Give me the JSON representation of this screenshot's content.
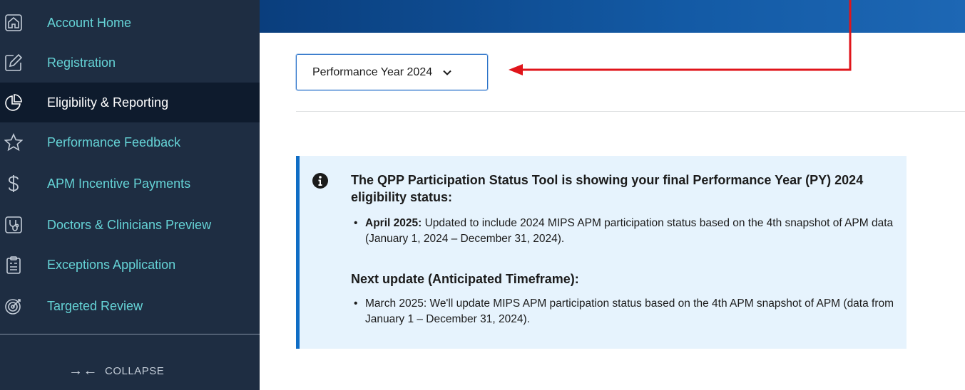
{
  "sidebar": {
    "items": [
      {
        "label": "Account Home",
        "icon": "home-icon"
      },
      {
        "label": "Registration",
        "icon": "edit-icon"
      },
      {
        "label": "Eligibility & Reporting",
        "icon": "pie-chart-icon",
        "active": true
      },
      {
        "label": "Performance Feedback",
        "icon": "star-icon"
      },
      {
        "label": "APM Incentive Payments",
        "icon": "dollar-icon"
      },
      {
        "label": "Doctors & Clinicians Preview",
        "icon": "stethoscope-icon"
      },
      {
        "label": "Exceptions Application",
        "icon": "clipboard-icon"
      },
      {
        "label": "Targeted Review",
        "icon": "target-icon"
      }
    ],
    "collapse_label": "COLLAPSE",
    "collapse_arrows": "→←"
  },
  "year_select": {
    "value": "Performance Year 2024"
  },
  "alert": {
    "title": "The QPP Participation Status Tool is showing your final Performance Year (PY) 2024 eligibility status:",
    "bullet1_bold": "April 2025:",
    "bullet1_text": " Updated to include 2024 MIPS APM participation status based on the 4th snapshot of APM data (January 1, 2024 – December 31, 2024).",
    "subtitle": "Next update (Anticipated Timeframe):",
    "bullet2_text": "March 2025: We'll update MIPS APM participation status based on the 4th APM snapshot of APM (data from January 1 – December 31, 2024)."
  },
  "colors": {
    "sidebar_bg": "#1e2d42",
    "sidebar_active_bg": "#0e1b2d",
    "sidebar_text": "#65d3d6",
    "alert_bg": "#e6f3fd",
    "alert_border": "#0f6dc5",
    "annotation": "#e0151b"
  }
}
